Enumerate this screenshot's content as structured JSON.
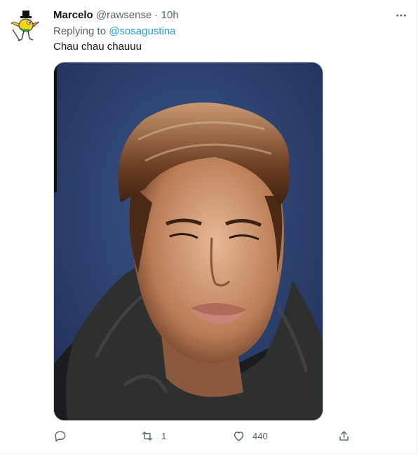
{
  "tweet": {
    "author_name": "Marcelo",
    "author_handle": "@rawsense",
    "separator": "·",
    "timestamp": "10h",
    "replying_prefix": "Replying to",
    "replying_to": "@sosagustina",
    "text": "Chau chau chauuu",
    "avatar_icon": "cartoon-bird-top-hat",
    "more_icon": "more-dots-icon"
  },
  "actions": {
    "reply_icon": "reply-icon",
    "retweet_icon": "retweet-icon",
    "retweet_count": "1",
    "like_icon": "heart-icon",
    "like_count": "440",
    "share_icon": "share-icon"
  },
  "colors": {
    "text": "#0f1419",
    "secondary": "#536471",
    "link": "#1d9bf0",
    "border": "#eff3f4"
  }
}
